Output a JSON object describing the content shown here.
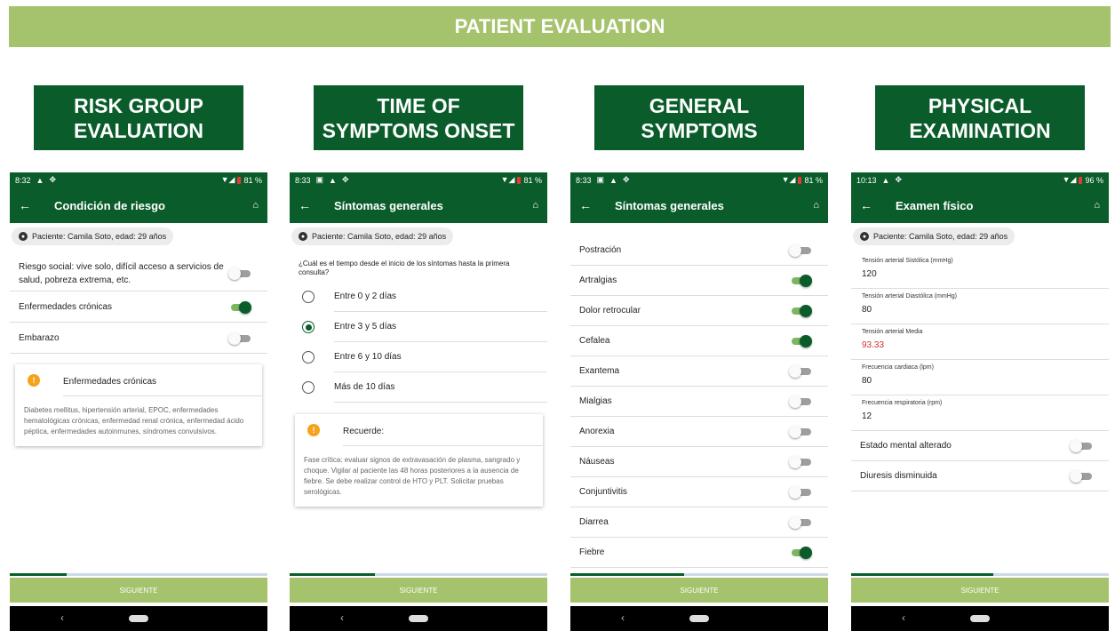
{
  "banner": "PATIENT EVALUATION",
  "sections": [
    {
      "line1": "RISK GROUP",
      "line2": "EVALUATION"
    },
    {
      "line1": "TIME OF",
      "line2": "SYMPTOMS ONSET"
    },
    {
      "line1": "GENERAL",
      "line2": "SYMPTOMS"
    },
    {
      "line1": "PHYSICAL",
      "line2": "EXAMINATION"
    }
  ],
  "common": {
    "next": "SIGUIENTE",
    "patient": "Paciente: Camila Soto, edad: 29 años"
  },
  "phones": [
    {
      "time": "8:32",
      "battery": "81 %",
      "title": "Condición de riesgo",
      "progress_pct": 22,
      "rows": [
        {
          "label": "Riesgo social: vive solo, difícil acceso a servicios de salud, pobreza extrema, etc.",
          "on": false
        },
        {
          "label": "Enfermedades crónicas",
          "on": true
        },
        {
          "label": "Embarazo",
          "on": false
        }
      ],
      "card": {
        "title": "Enfermedades crónicas",
        "body": "Diabetes mellitus, hipertensión arterial, EPOC, enfermedades hematológicas crónicas, enfermedad renal crónica, enfermedad ácido péptica, enfermedades autoinmunes, síndromes convulsivos."
      }
    },
    {
      "time": "8:33",
      "battery": "81 %",
      "title": "Síntomas generales",
      "progress_pct": 33,
      "question": "¿Cuál es el tiempo desde el inicio de los síntomas hasta la primera consulta?",
      "options": [
        {
          "label": "Entre 0 y 2 días",
          "selected": false
        },
        {
          "label": "Entre 3 y 5 días",
          "selected": true
        },
        {
          "label": "Entre 6 y 10 días",
          "selected": false
        },
        {
          "label": "Más de 10 días",
          "selected": false
        }
      ],
      "card": {
        "title": "Recuerde:",
        "body": "Fase crítica: evaluar signos de extravasación de plasma, sangrado y choque. Vigilar al paciente las 48 horas posteriores a la ausencia de fiebre. Se debe realizar control de HTO y PLT. Solicitar pruebas serológicas."
      }
    },
    {
      "time": "8:33",
      "battery": "81 %",
      "title": "Síntomas generales",
      "progress_pct": 44,
      "rows": [
        {
          "label": "Postración",
          "on": false
        },
        {
          "label": "Artralgias",
          "on": true
        },
        {
          "label": "Dolor retrocular",
          "on": true
        },
        {
          "label": "Cefalea",
          "on": true
        },
        {
          "label": "Exantema",
          "on": false
        },
        {
          "label": "Mialgias",
          "on": false
        },
        {
          "label": "Anorexia",
          "on": false
        },
        {
          "label": "Náuseas",
          "on": false
        },
        {
          "label": "Conjuntivitis",
          "on": false
        },
        {
          "label": "Diarrea",
          "on": false
        },
        {
          "label": "Fiebre",
          "on": true
        }
      ]
    },
    {
      "time": "10:13",
      "battery": "96 %",
      "title": "Examen físico",
      "progress_pct": 55,
      "fields": [
        {
          "label": "Tensión arterial Sistólica (mmHg)",
          "value": "120",
          "color": "#222222"
        },
        {
          "label": "Tensión arterial Diastólica (mmHg)",
          "value": "80",
          "color": "#222222"
        },
        {
          "label": "Tensión arterial Media",
          "value": "93.33",
          "color": "#d32f2f"
        },
        {
          "label": "Frecuencia cardiaca (lpm)",
          "value": "80",
          "color": "#222222"
        },
        {
          "label": "Frecuencia respiratoria (rpm)",
          "value": "12",
          "color": "#222222"
        }
      ],
      "rows": [
        {
          "label": "Estado mental alterado",
          "on": false
        },
        {
          "label": "Diuresis disminuida",
          "on": false
        }
      ]
    }
  ]
}
